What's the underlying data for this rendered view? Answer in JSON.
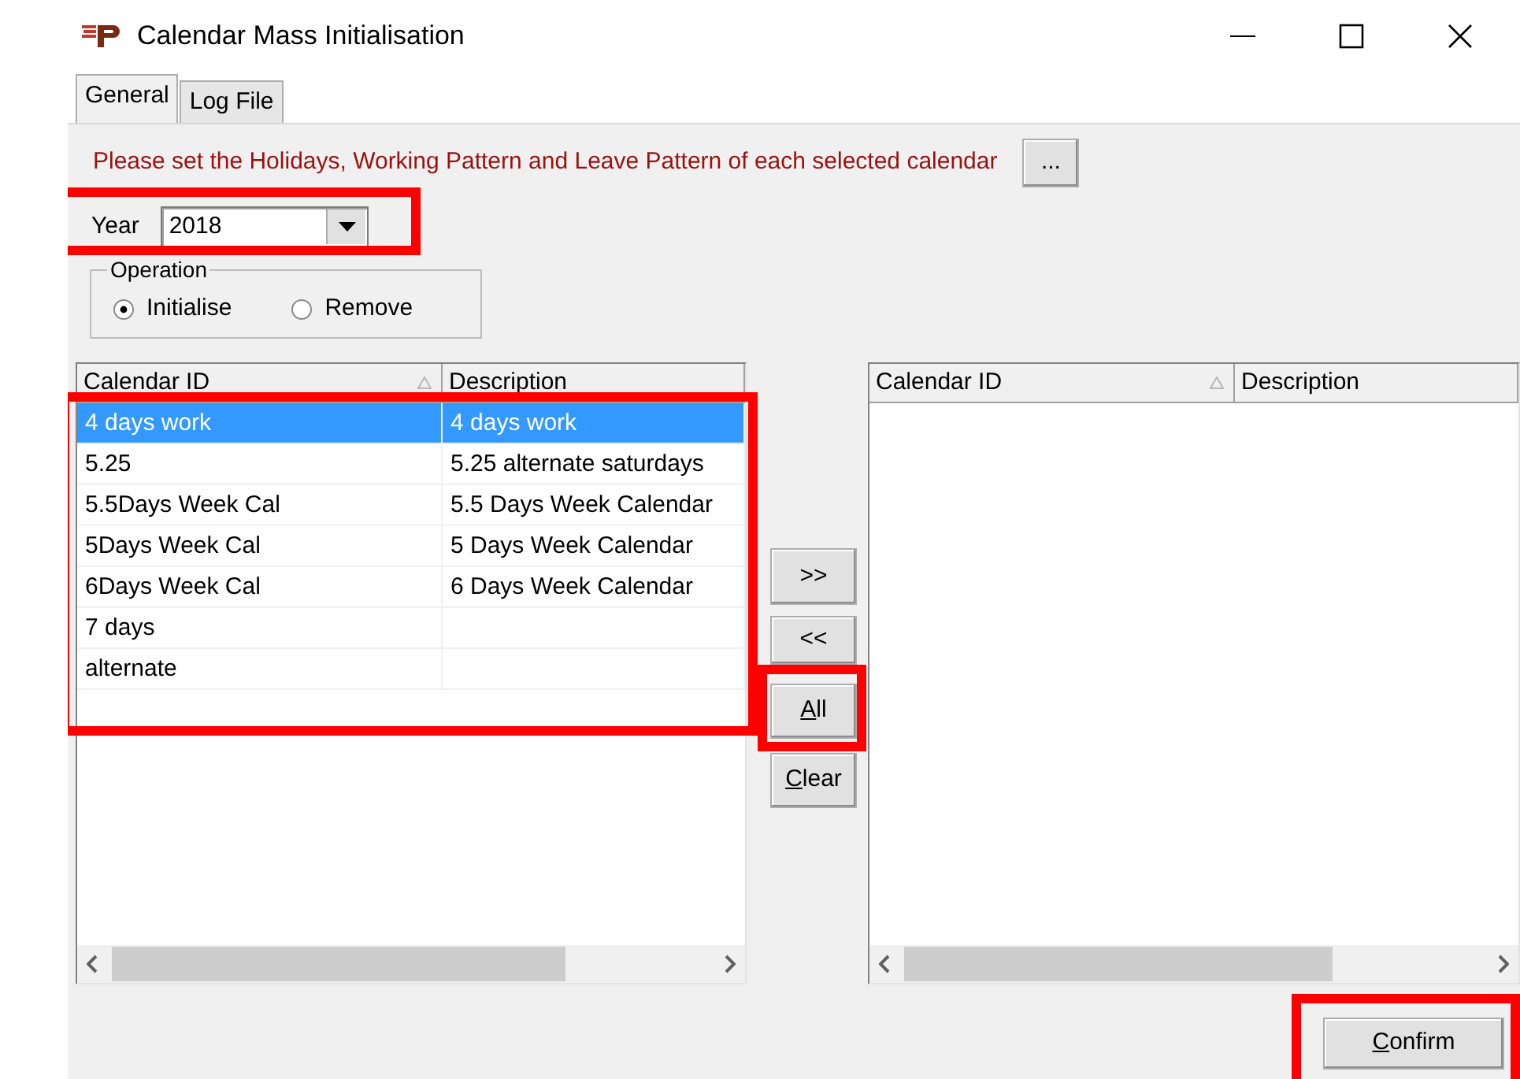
{
  "window": {
    "title": "Calendar Mass Initialisation"
  },
  "tabs": [
    {
      "label": "General",
      "selected": true
    },
    {
      "label": "Log File",
      "selected": false
    }
  ],
  "message": "Please set the Holidays, Working Pattern and Leave Pattern of each selected calendar",
  "pattern_button": "...",
  "year": {
    "label": "Year",
    "value": "2018"
  },
  "operation": {
    "legend": "Operation",
    "options": [
      {
        "label": "Initialise",
        "selected": true
      },
      {
        "label": "Remove",
        "selected": false
      }
    ]
  },
  "available_list": {
    "columns": [
      {
        "label": "Calendar ID",
        "sorted": true
      },
      {
        "label": "Description",
        "sorted": false
      }
    ],
    "rows": [
      {
        "cells": [
          "4 days work",
          "4 days work"
        ],
        "selected": true
      },
      {
        "cells": [
          "5.25",
          "5.25 alternate saturdays"
        ],
        "selected": false
      },
      {
        "cells": [
          "5.5Days Week Cal",
          "5.5 Days Week Calendar"
        ],
        "selected": false
      },
      {
        "cells": [
          "5Days Week Cal",
          "5 Days Week Calendar"
        ],
        "selected": false
      },
      {
        "cells": [
          "6Days Week Cal",
          "6 Days Week Calendar"
        ],
        "selected": false
      },
      {
        "cells": [
          "7 days",
          ""
        ],
        "selected": false
      },
      {
        "cells": [
          "alternate",
          ""
        ],
        "selected": false
      }
    ]
  },
  "move_buttons": [
    {
      "label": ">>",
      "mnemonic_underlined": false
    },
    {
      "label": "<<",
      "mnemonic_underlined": false
    },
    {
      "label": "All",
      "mnemonic_underlined": true
    },
    {
      "label": "Clear",
      "mnemonic_underlined": true
    }
  ],
  "selected_list": {
    "columns": [
      {
        "label": "Calendar ID",
        "sorted": true
      },
      {
        "label": "Description",
        "sorted": false
      }
    ]
  },
  "confirm_button": {
    "label": "Confirm",
    "mnemonic_underlined": true
  }
}
